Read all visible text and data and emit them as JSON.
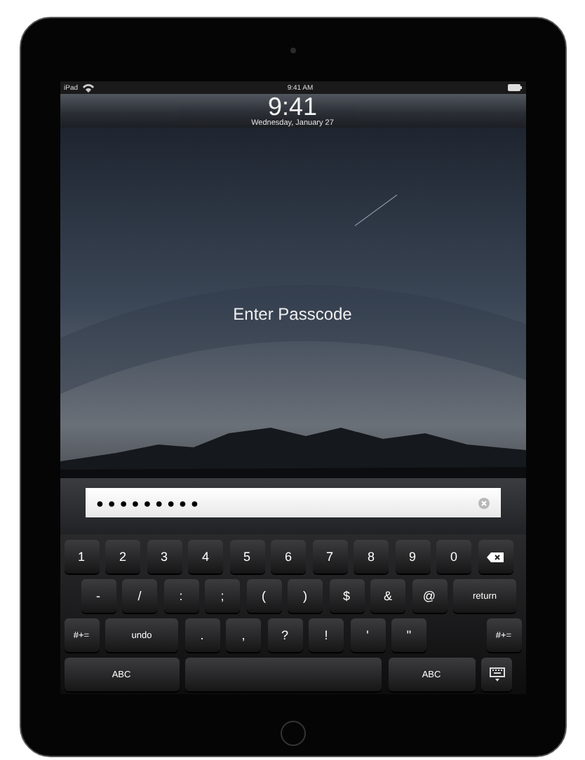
{
  "status_bar": {
    "device": "iPad",
    "time": "9:41 AM"
  },
  "lock": {
    "time": "9:41",
    "date": "Wednesday, January 27"
  },
  "prompt": "Enter Passcode",
  "passcode_field": {
    "value": "●●●●●●●●●"
  },
  "keyboard": {
    "rows": [
      [
        {
          "label": "1",
          "kind": "key"
        },
        {
          "label": "2",
          "kind": "key"
        },
        {
          "label": "3",
          "kind": "key"
        },
        {
          "label": "4",
          "kind": "key"
        },
        {
          "label": "5",
          "kind": "key"
        },
        {
          "label": "6",
          "kind": "key"
        },
        {
          "label": "7",
          "kind": "key"
        },
        {
          "label": "8",
          "kind": "key"
        },
        {
          "label": "9",
          "kind": "key"
        },
        {
          "label": "0",
          "kind": "key"
        },
        {
          "kind": "delete"
        }
      ],
      [
        {
          "label": "-",
          "kind": "key"
        },
        {
          "label": "/",
          "kind": "key"
        },
        {
          "label": ":",
          "kind": "key"
        },
        {
          "label": ";",
          "kind": "key"
        },
        {
          "label": "(",
          "kind": "key"
        },
        {
          "label": ")",
          "kind": "key"
        },
        {
          "label": "$",
          "kind": "key"
        },
        {
          "label": "&",
          "kind": "key"
        },
        {
          "label": "@",
          "kind": "key"
        },
        {
          "label": "return",
          "kind": "return"
        }
      ],
      [
        {
          "label": "#+=",
          "kind": "shift"
        },
        {
          "label": "undo",
          "kind": "undo"
        },
        {
          "label": ".",
          "kind": "key"
        },
        {
          "label": ",",
          "kind": "key"
        },
        {
          "label": "?",
          "kind": "key"
        },
        {
          "label": "!",
          "kind": "key"
        },
        {
          "label": "'",
          "kind": "key"
        },
        {
          "label": "\"",
          "kind": "key"
        },
        {
          "label": "#+=",
          "kind": "shift"
        }
      ],
      [
        {
          "label": "ABC",
          "kind": "mode"
        },
        {
          "kind": "space"
        },
        {
          "label": "ABC",
          "kind": "mode2"
        },
        {
          "kind": "hide"
        }
      ]
    ]
  }
}
